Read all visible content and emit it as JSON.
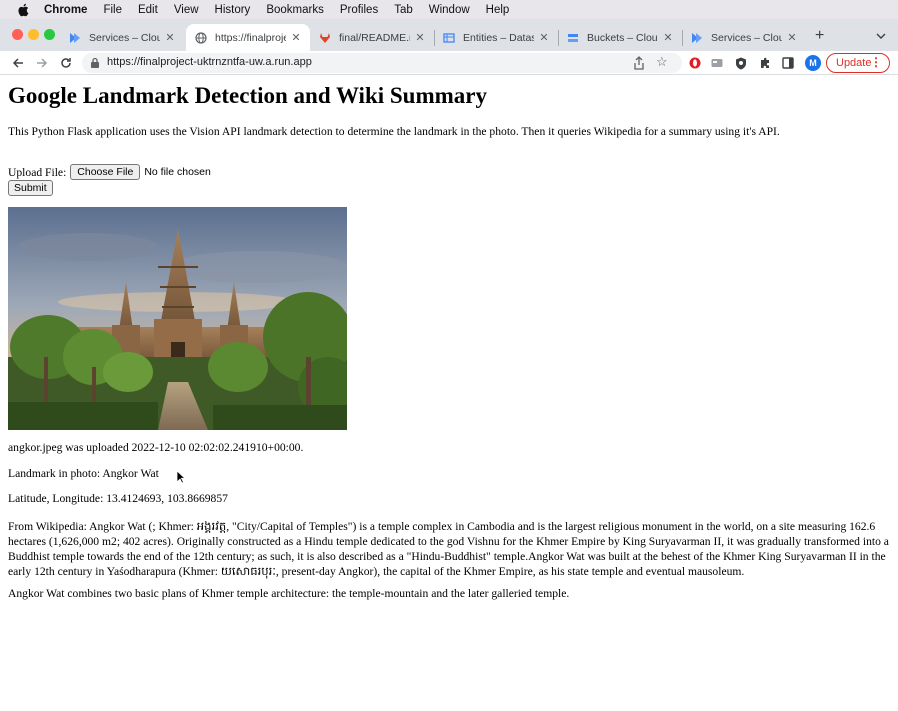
{
  "menubar": {
    "items": [
      "Chrome",
      "File",
      "Edit",
      "View",
      "History",
      "Bookmarks",
      "Profiles",
      "Tab",
      "Window",
      "Help"
    ]
  },
  "tabs": [
    {
      "title": "Services – Cloud R",
      "icon": "cloud-run-icon",
      "active": false
    },
    {
      "title": "https://finalproject",
      "icon": "globe-icon",
      "active": true
    },
    {
      "title": "final/README.md",
      "icon": "gitlab-icon",
      "active": false
    },
    {
      "title": "Entities – Datastor",
      "icon": "datastore-icon",
      "active": false
    },
    {
      "title": "Buckets – Cloud S",
      "icon": "cloud-storage-icon",
      "active": false
    },
    {
      "title": "Services – Cloud R",
      "icon": "cloud-run-icon",
      "active": false
    }
  ],
  "toolbar": {
    "url": "https://finalproject-uktrnzntfa-uw.a.run.app",
    "avatar_letter": "M",
    "update_label": "Update"
  },
  "page": {
    "title": "Google Landmark Detection and Wiki Summary",
    "intro": "This Python Flask application uses the Vision API landmark detection to determine the landmark in the photo. Then it queries Wikipedia for a summary using it's API.",
    "upload_label": "Upload File:",
    "choose_file_label": "Choose File",
    "no_file_text": "No file chosen",
    "submit_label": "Submit",
    "uploaded_text": "angkor.jpeg was uploaded 2022-12-10 02:02:02.241910+00:00.",
    "landmark_text": "Landmark in photo: Angkor Wat",
    "latlng_text": "Latitude, Longitude: 13.4124693, 103.8669857",
    "wiki_paragraph": "From Wikipedia: Angkor Wat (; Khmer: អង្គរវត្ត, \"City/Capital of Temples\") is a temple complex in Cambodia and is the largest religious monument in the world, on a site measuring 162.6 hectares (1,626,000 m2; 402 acres). Originally constructed as a Hindu temple dedicated to the god Vishnu for the Khmer Empire by King Suryavarman II, it was gradually transformed into a Buddhist temple towards the end of the 12th century; as such, it is also described as a \"Hindu-Buddhist\" temple.Angkor Wat was built at the behest of the Khmer King Suryavarman II in the early 12th century in Yaśodharapura (Khmer: យសោធរបុរៈ, present-day Angkor), the capital of the Khmer Empire, as his state temple and eventual mausoleum.",
    "wiki_paragraph_2": "Angkor Wat combines two basic plans of Khmer temple architecture: the temple-mountain and the later galleried temple."
  },
  "colors": {
    "tabstrip_bg": "#dee1e6",
    "update_red": "#d93025",
    "avatar_blue": "#1a73e8"
  }
}
